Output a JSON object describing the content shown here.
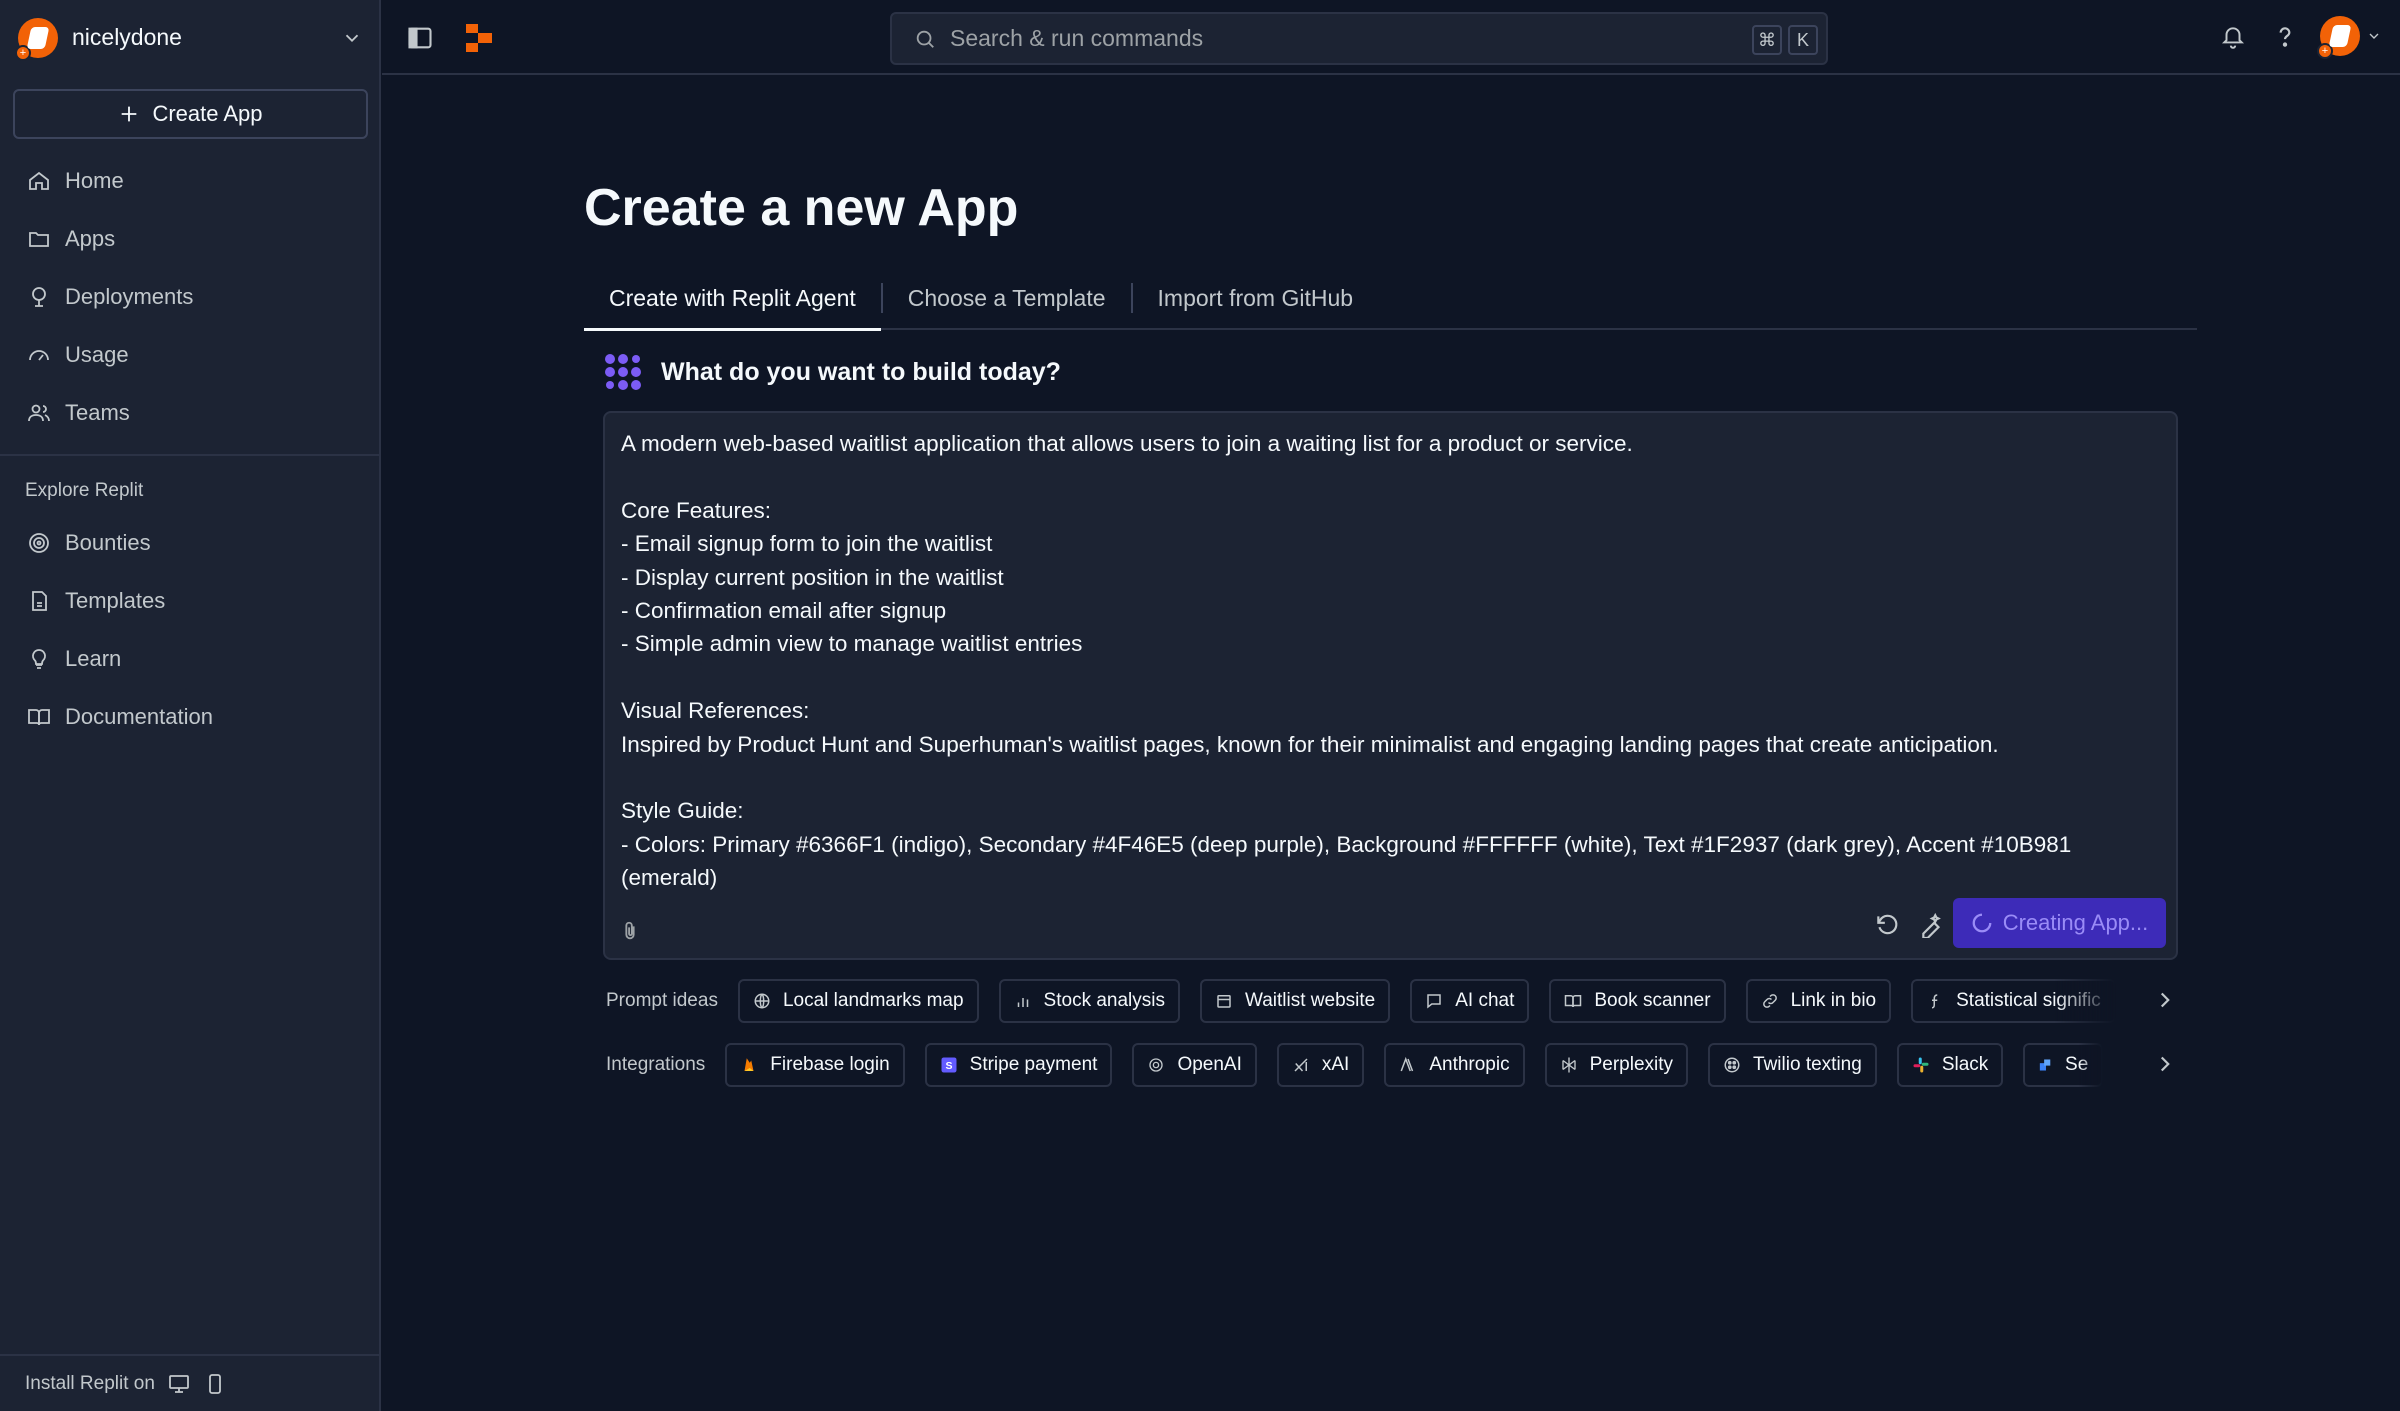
{
  "workspace": {
    "name": "nicelydone"
  },
  "sidebar": {
    "create_label": "Create App",
    "items": [
      {
        "label": "Home",
        "icon": "home-icon"
      },
      {
        "label": "Apps",
        "icon": "folder-icon"
      },
      {
        "label": "Deployments",
        "icon": "deployments-icon"
      },
      {
        "label": "Usage",
        "icon": "gauge-icon"
      },
      {
        "label": "Teams",
        "icon": "users-icon"
      }
    ],
    "explore_title": "Explore Replit",
    "explore_items": [
      {
        "label": "Bounties",
        "icon": "bounty-icon"
      },
      {
        "label": "Templates",
        "icon": "template-icon"
      },
      {
        "label": "Learn",
        "icon": "lightbulb-icon"
      },
      {
        "label": "Documentation",
        "icon": "book-icon"
      }
    ],
    "footer_label": "Install Replit on"
  },
  "search": {
    "placeholder": "Search & run commands",
    "shortcut_mod": "⌘",
    "shortcut_key": "K"
  },
  "main": {
    "title": "Create a new App",
    "tabs": [
      {
        "label": "Create with Replit Agent",
        "active": true
      },
      {
        "label": "Choose a Template",
        "active": false
      },
      {
        "label": "Import from GitHub",
        "active": false
      }
    ],
    "prompt_heading": "What do you want to build today?",
    "prompt_text": "A modern web-based waitlist application that allows users to join a waiting list for a product or service.\n\nCore Features:\n- Email signup form to join the waitlist\n- Display current position in the waitlist\n- Confirmation email after signup\n- Simple admin view to manage waitlist entries\n\nVisual References:\nInspired by Product Hunt and Superhuman's waitlist pages, known for their minimalist and engaging landing pages that create anticipation.\n\nStyle Guide:\n- Colors: Primary #6366F1 (indigo), Secondary #4F46E5 (deep purple), Background #FFFFFF (white), Text #1F2937 (dark grey), Accent #10B981 (emerald)",
    "submit_label": "Creating App...",
    "prompt_ideas_label": "Prompt ideas",
    "prompt_ideas": [
      "Local landmarks map",
      "Stock analysis",
      "Waitlist website",
      "AI chat",
      "Book scanner",
      "Link in bio",
      "Statistical signific"
    ],
    "integrations_label": "Integrations",
    "integrations": [
      "Firebase login",
      "Stripe payment",
      "OpenAI",
      "xAI",
      "Anthropic",
      "Perplexity",
      "Twilio texting",
      "Slack",
      "Se"
    ]
  },
  "colors": {
    "accent": "#f26207",
    "agent_purple": "#7c5cf5",
    "background": "#0e1525",
    "panel": "#1c2333"
  }
}
